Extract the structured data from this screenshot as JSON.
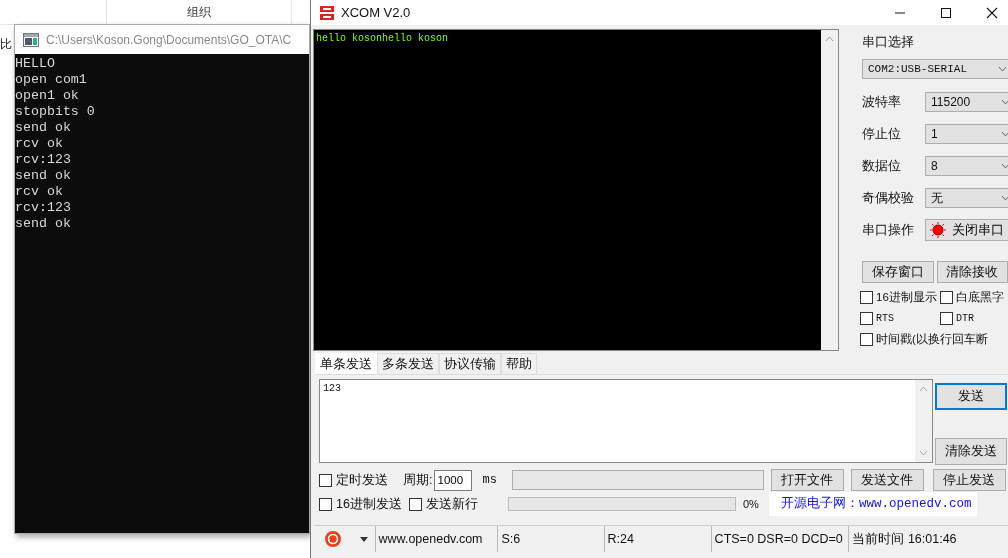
{
  "background_window": {
    "column_header": "组织",
    "side_text": "比"
  },
  "console": {
    "title": "C:\\Users\\Koson.Gong\\Documents\\GO_OTA\\C",
    "lines": [
      "HELLO",
      "open com1",
      "open1 ok",
      "stopbits 0",
      "send ok",
      "rcv ok",
      "rcv:123",
      "send ok",
      "rcv ok",
      "rcv:123",
      "send ok"
    ]
  },
  "xcom": {
    "title": "XCOM V2.0",
    "receive_text": "hello kosonhello koson",
    "settings": [
      {
        "kind": "wide-select",
        "label": "串口选择",
        "value": "COM2:USB-SERIAL"
      },
      {
        "kind": "select",
        "label": "波特率",
        "value": "115200"
      },
      {
        "kind": "select",
        "label": "停止位",
        "value": "1"
      },
      {
        "kind": "select",
        "label": "数据位",
        "value": "8"
      },
      {
        "kind": "select",
        "label": "奇偶校验",
        "value": "无"
      },
      {
        "kind": "toggle",
        "label": "串口操作",
        "value": "关闭串口",
        "on": true
      }
    ],
    "panel_buttons": [
      "保存窗口",
      "清除接收"
    ],
    "options": [
      {
        "label": "16进制显示",
        "checked": false,
        "kind": "half"
      },
      {
        "label": "白底黑字",
        "checked": false,
        "kind": "half"
      },
      {
        "label": "RTS",
        "checked": false,
        "kind": "half"
      },
      {
        "label": "DTR",
        "checked": false,
        "kind": "half"
      },
      {
        "label": "时间戳(以换行回车断",
        "checked": false,
        "kind": "full"
      }
    ],
    "tabs": [
      {
        "label": "单条发送",
        "selected": true
      },
      {
        "label": "多条发送",
        "selected": false
      },
      {
        "label": "协议传输",
        "selected": false
      },
      {
        "label": "帮助",
        "selected": false
      }
    ],
    "send_text": "123",
    "send_buttons": [
      {
        "label": "发送",
        "focused": true
      },
      {
        "label": "清除发送",
        "focused": false
      }
    ],
    "timer": {
      "label": "定时发送",
      "checked": false
    },
    "period_label": "周期:",
    "period_value": "1000",
    "period_unit": "ms",
    "file_buttons": [
      "打开文件",
      "发送文件",
      "停止发送"
    ],
    "hex_send": {
      "label": "16进制发送",
      "checked": false
    },
    "new_line": {
      "label": "发送新行",
      "checked": false
    },
    "progress": {
      "level": 0,
      "reading": "0%"
    },
    "promo": "开源电子网：www.openedv.com",
    "status_bar": [
      "www.openedv.com",
      "S:6",
      "R:24",
      "CTS=0 DSR=0 DCD=0",
      "当前时间 16:01:46"
    ]
  }
}
